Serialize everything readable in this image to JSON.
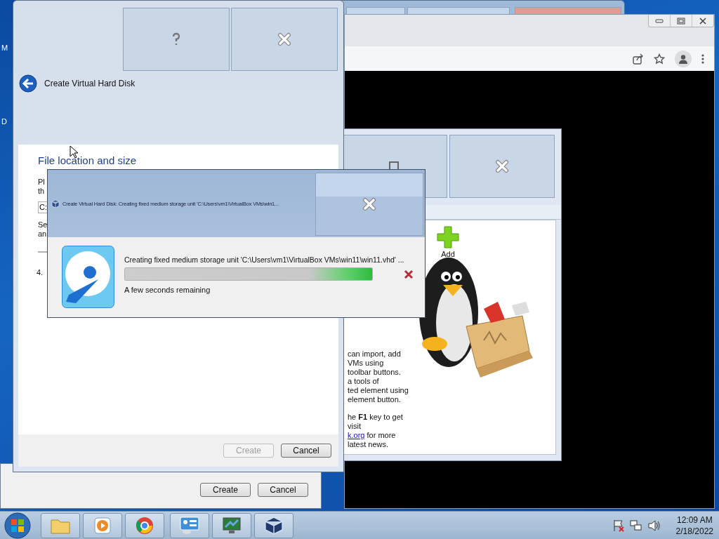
{
  "desktop": {
    "icon_labels": [
      "M",
      "D"
    ]
  },
  "manager_window": {
    "toolbar": [
      {
        "label": "Add"
      }
    ],
    "paragraphs": [
      [
        {
          "kind": "text",
          "text": "can import, add"
        },
        {
          "kind": "text",
          "text": "VMs using"
        },
        {
          "kind": "text",
          "text": "toolbar buttons."
        },
        {
          "kind": "text",
          "text": "a tools of"
        },
        {
          "kind": "text",
          "text": "ted element using"
        },
        {
          "kind": "text",
          "text": "element button."
        }
      ],
      [
        {
          "kind": "text",
          "text": "he **F1** key to get"
        },
        {
          "kind": "text",
          "text": "visit"
        },
        {
          "kind": "link",
          "link": "k.org",
          "text": " for more"
        },
        {
          "kind": "text",
          "text": "latest news."
        }
      ]
    ]
  },
  "parent_dialog": {
    "buttons": [
      {
        "label": "Create",
        "disabled": false
      },
      {
        "label": "Cancel",
        "disabled": false
      }
    ]
  },
  "wizard": {
    "title": "Create Virtual Hard Disk",
    "heading": "File location and size",
    "fragments_top": [
      "Pl",
      "th"
    ],
    "path_field": {
      "value": "C:"
    },
    "fragments_mid": [
      "Se",
      "an"
    ],
    "size_fragment": "4.",
    "buttons": [
      {
        "label": "Create",
        "disabled": true
      },
      {
        "label": "Cancel",
        "disabled": false
      }
    ]
  },
  "progress_dialog": {
    "title": "Create Virtual Hard Disk: Creating fixed medium storage unit 'C:\\Users\\vm1\\VirtualBox VMs\\win1...",
    "message": "Creating fixed medium storage unit 'C:\\Users\\vm1\\VirtualBox VMs\\win11\\win11.vhd' ...",
    "level": 1,
    "status": "A few seconds remaining"
  },
  "taskbar": {
    "time": "12:09 AM",
    "date": "2/18/2022"
  }
}
